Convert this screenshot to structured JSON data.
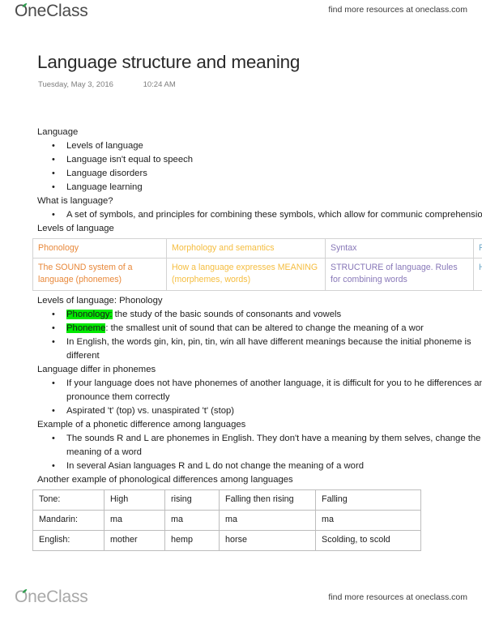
{
  "header": {
    "logo_text": "OneClass",
    "logo_icon": "leaf-icon",
    "tagline": "find more resources at oneclass.com"
  },
  "title": {
    "heading": "Language structure and meaning",
    "date": "Tuesday,  May 3, 2016",
    "time": "10:24 AM"
  },
  "content": {
    "s1_heading": "Language",
    "s1_bullets": [
      "Levels of language",
      "Language isn't equal to speech",
      "Language disorders",
      "Language learning"
    ],
    "s2_heading": "What is language?",
    "s2_bullet": "A set of symbols, and principles for combining these symbols, which allow for communic comprehension",
    "s3_heading": "Levels of language",
    "s4_heading": "Levels of language: Phonology",
    "s4_b1_mark": "Phonology:",
    "s4_b1_rest": " the study of the basic sounds of consonants and vowels",
    "s4_b2_mark": "Phoneme",
    "s4_b2_rest": ": the smallest unit of sound that can be altered to change the meaning of a wor",
    "s4_b3": "In English, the words gin, kin, pin, tin, win all have different meanings because the initial phoneme is different",
    "s5_heading": "Language differ in phonemes",
    "s5_b1": "If your language does not have phonemes of another language, it is difficult for you to he differences and to pronounce them correctly",
    "s5_b2": "Aspirated 't' (top) vs. unaspirated 't' (stop)",
    "s6_heading": "Example of a phonetic difference among languages",
    "s6_b1": "The sounds R and L are phonemes in English. They don't have a meaning by them selves, change the meaning of a word",
    "s6_b2": "In several Asian languages R and L do not change the meaning of a word",
    "s7_heading": "Another example of phonological differences among languages"
  },
  "levels_table": {
    "headers": [
      "Phonology",
      "Morphology and semantics",
      "Syntax",
      "Pragmat"
    ],
    "cells": [
      "The SOUND system of a language (phonemes)",
      "How a language expresses MEANING (morphemes, words)",
      "STRUCTURE of language. Rules for combining words",
      "How lan used in C"
    ],
    "colors": {
      "phonology": "#e8883a",
      "morphology": "#f5bd3f",
      "syntax": "#8878b8",
      "pragmatics": "#6ea8c9"
    }
  },
  "tone_table": {
    "rows": [
      [
        "Tone:",
        "High",
        "rising",
        "Falling then rising",
        "Falling"
      ],
      [
        "Mandarin:",
        "ma",
        "ma",
        "ma",
        "ma"
      ],
      [
        "English:",
        "mother",
        "hemp",
        "horse",
        "Scolding, to scold"
      ]
    ]
  },
  "highlight_color": "#00e800",
  "footer": {
    "logo_text": "OneClass",
    "logo_icon": "leaf-icon",
    "tagline": "find more resources at oneclass.com"
  }
}
